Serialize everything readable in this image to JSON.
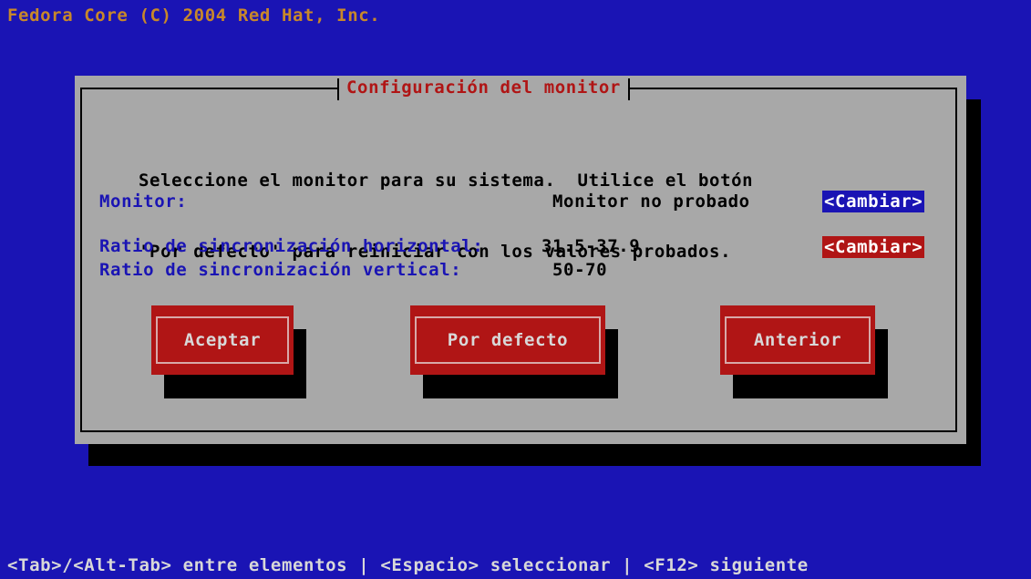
{
  "header": {
    "copyright": "Fedora Core (C) 2004 Red Hat, Inc."
  },
  "dialog": {
    "title": "Configuración del monitor",
    "instruction_line1": "Seleccione el monitor para su sistema.  Utilice el botón",
    "instruction_line2": "'Por defecto' para reiniciar con los valores probados.",
    "monitor_label": "Monitor:",
    "monitor_value": "Monitor no probado",
    "monitor_change": "<Cambiar>",
    "hsync_label": "Ratio de sincronización horizontal:",
    "hsync_value": "31.5-37.9",
    "hsync_change": "<Cambiar>",
    "vsync_label": "Ratio de sincronización vertical:",
    "vsync_value": "50-70",
    "buttons": {
      "accept": "Aceptar",
      "default": "Por defecto",
      "back": "Anterior"
    }
  },
  "footer": {
    "help": "<Tab>/<Alt-Tab> entre elementos | <Espacio> seleccionar | <F12> siguiente"
  },
  "colors": {
    "background": "#1a14b4",
    "dialog": "#a8a8a8",
    "accent_red": "#b01515",
    "header_text": "#c8882a"
  }
}
